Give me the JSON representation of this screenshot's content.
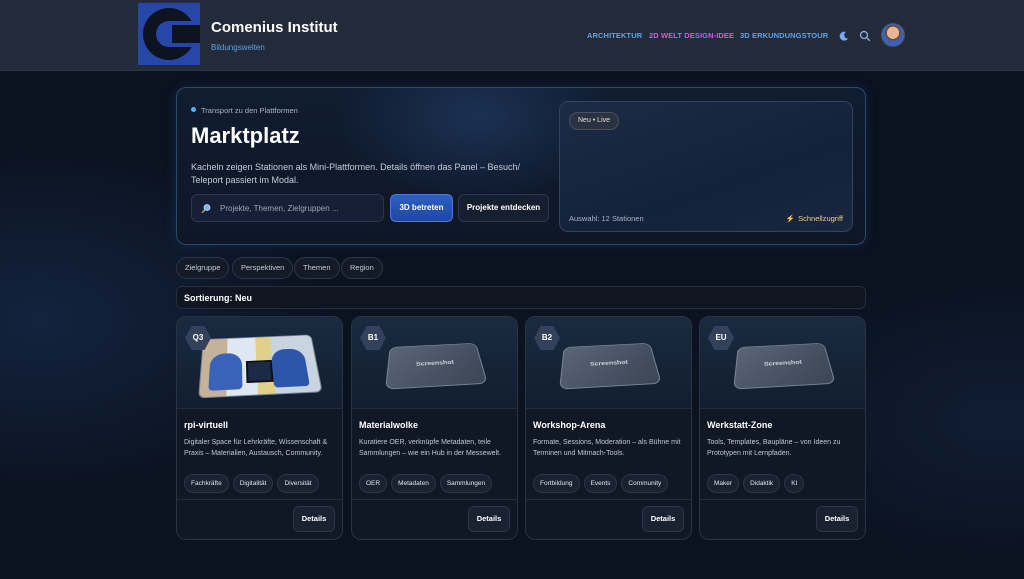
{
  "header": {
    "title": "Comenius Institut",
    "subtitle": "Bildungswelten",
    "nav": [
      "ARCHITEKTUR",
      "2D WELT DESIGN-IDEE",
      "3D ERKUNDUNGSTOUR"
    ]
  },
  "hero": {
    "kicker": "Transport zu den Plattformen",
    "title": "Marktplatz",
    "description": "Kacheln zeigen Stationen als Mini-Plattformen. Details öffnen das Panel – Besuch/ Teleport passiert im Modal.",
    "search_placeholder": "Projekte, Themen, Zielgruppen ...",
    "btn_3d": "3D betreten",
    "btn_discover": "Projekte entdecken",
    "badge": "Neu • Live",
    "selection": "Auswahl: 12 Stationen",
    "quick_access": "Schnellzugriff"
  },
  "filters": [
    "Zielgruppe",
    "Perspektiven",
    "Themen",
    "Region"
  ],
  "sort_label": "Sortierung: Neu",
  "cards": [
    {
      "code": "Q3",
      "title": "rpi-virtuell",
      "description": "Digitaler Space für Lehrkräfte, Wissenschaft & Praxis – Materialien, Austausch, Community.",
      "tags": [
        "Fachkräfte",
        "Digitalität",
        "Diversität"
      ],
      "details": "Details"
    },
    {
      "code": "B1",
      "title": "Materialwolke",
      "description": "Kuratiere OER, verknüpfe Metadaten, teile Sammlungen – wie ein Hub in der Messewelt.",
      "tags": [
        "OER",
        "Metadaten",
        "Sammlungen"
      ],
      "details": "Details",
      "tile_label": "Screenshot"
    },
    {
      "code": "B2",
      "title": "Workshop-Arena",
      "description": "Formate, Sessions, Moderation – als Bühne mit Terminen und Mitmach-Tools.",
      "tags": [
        "Fortbildung",
        "Events",
        "Community"
      ],
      "details": "Details",
      "tile_label": "Screenshot"
    },
    {
      "code": "EU",
      "title": "Werkstatt-Zone",
      "description": "Tools, Templates, Baupläne – von Ideen zu Prototypen mit Lernpfaden.",
      "tags": [
        "Maker",
        "Didaktik",
        "KI"
      ],
      "details": "Details",
      "tile_label": "Screenshot"
    }
  ],
  "colors": {
    "background": "#0b1220",
    "header": "#232a39",
    "accent_blue": "#5ea3e8",
    "accent_pink": "#d65ae0",
    "primary_button": "#2d5fc4"
  }
}
